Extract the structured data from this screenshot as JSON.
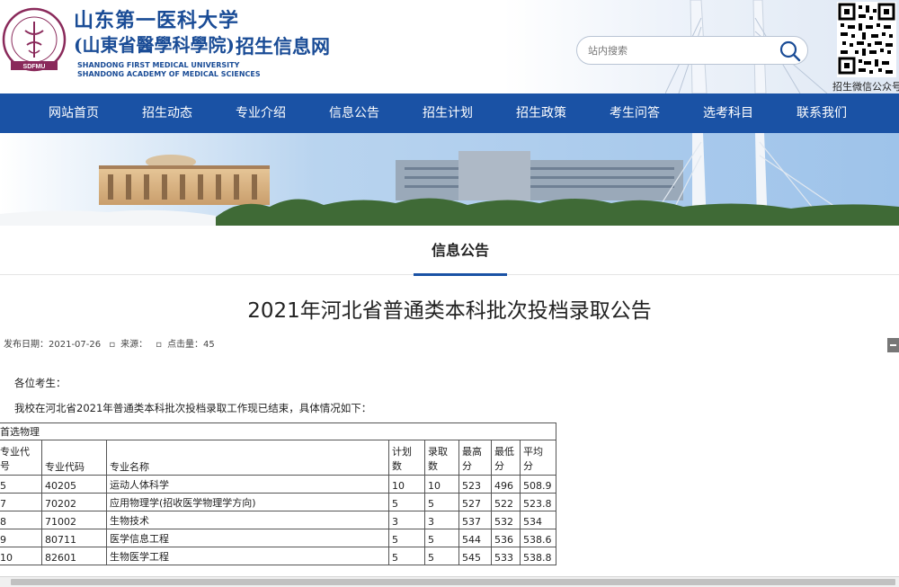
{
  "header": {
    "cn_name_line1": "山东第一医科大学",
    "cn_name_line2": "(山東省醫學科學院)",
    "en_line1": "SHANDONG FIRST MEDICAL UNIVERSITY",
    "en_line2": "SHANDONG ACADEMY OF MEDICAL SCIENCES",
    "logo_abbr": "SDFMU",
    "site_title": "招生信息网",
    "search_placeholder": "站内搜索",
    "qr_label": "招生微信公众号"
  },
  "nav": [
    {
      "label": "网站首页"
    },
    {
      "label": "招生动态"
    },
    {
      "label": "专业介绍"
    },
    {
      "label": "信息公告"
    },
    {
      "label": "招生计划"
    },
    {
      "label": "招生政策"
    },
    {
      "label": "考生问答"
    },
    {
      "label": "选考科目"
    },
    {
      "label": "联系我们"
    }
  ],
  "section_title": "信息公告",
  "article": {
    "title": "2021年河北省普通类本科批次投档录取公告",
    "publish": "发布日期：2021-07-26",
    "source": "来源：",
    "views": "点击量：45",
    "greeting": "各位考生：",
    "intro": "我校在河北省2021年普通类本科批次投档录取工作现已结束，具体情况如下："
  },
  "table": {
    "group_header": "首选物理",
    "headers": {
      "col0_line1": "专业代",
      "col0_line2": "号",
      "col1": "专业代码",
      "col2": "专业名称",
      "col3_line1": "计划",
      "col3_line2": "数",
      "col4_line1": "录取",
      "col4_line2": "数",
      "col5_line1": "最高",
      "col5_line2": "分",
      "col6_line1": "最低",
      "col6_line2": "分",
      "col7_line1": "平均",
      "col7_line2": "分"
    },
    "rows": [
      {
        "no": "5",
        "code": "40205",
        "name": "运动人体科学",
        "plan": "10",
        "admit": "10",
        "max": "523",
        "min": "496",
        "avg": "508.9"
      },
      {
        "no": "7",
        "code": "70202",
        "name": "应用物理学(招收医学物理学方向)",
        "plan": "5",
        "admit": "5",
        "max": "527",
        "min": "522",
        "avg": "523.8"
      },
      {
        "no": "8",
        "code": "71002",
        "name": "生物技术",
        "plan": "3",
        "admit": "3",
        "max": "537",
        "min": "532",
        "avg": "534"
      },
      {
        "no": "9",
        "code": "80711",
        "name": "医学信息工程",
        "plan": "5",
        "admit": "5",
        "max": "544",
        "min": "536",
        "avg": "538.6"
      },
      {
        "no": "10",
        "code": "82601",
        "name": "生物医学工程",
        "plan": "5",
        "admit": "5",
        "max": "545",
        "min": "533",
        "avg": "538.8"
      }
    ]
  }
}
